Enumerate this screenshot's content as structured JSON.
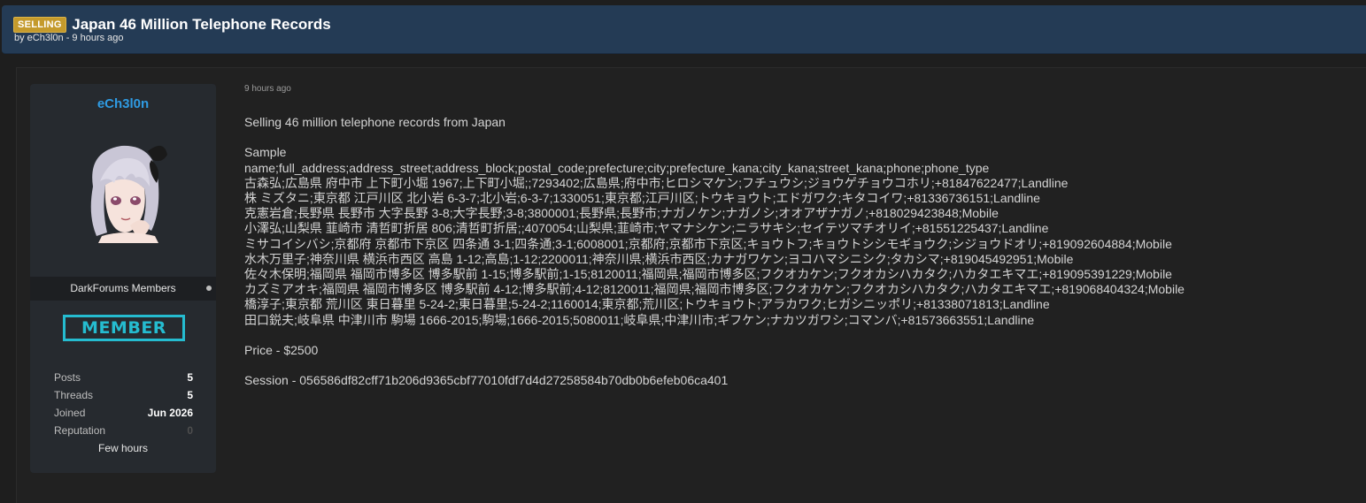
{
  "header": {
    "prefix": "SELLING",
    "title": "Japan 46 Million Telephone Records",
    "byline": "by eCh3l0n - 9 hours ago"
  },
  "user": {
    "name": "eCh3l0n",
    "group": "DarkForums Members",
    "rank": "MEMBER",
    "stats": [
      {
        "label": "Posts",
        "value": "5"
      },
      {
        "label": "Threads",
        "value": "5"
      },
      {
        "label": "Joined",
        "value": "Jun 2026"
      },
      {
        "label": "Reputation",
        "value": "0"
      }
    ],
    "last_seen": "Few hours"
  },
  "post": {
    "date": "9 hours ago",
    "intro": "Selling 46 million telephone records from Japan",
    "sample_label": "Sample",
    "sample_lines": [
      "name;full_address;address_street;address_block;postal_code;prefecture;city;prefecture_kana;city_kana;street_kana;phone;phone_type",
      "古森弘;広島県 府中市 上下町小堀 1967;上下町小堀;;7293402;広島県;府中市;ヒロシマケン;フチュウシ;ジョウゲチョウコホリ;+81847622477;Landline",
      "株 ミズタニ;東京都 江戸川区 北小岩 6-3-7;北小岩;6-3-7;1330051;東京都;江戸川区;トウキョウト;エドガワク;キタコイワ;+81336736151;Landline",
      "克憲岩倉;長野県 長野市 大字長野 3-8;大字長野;3-8;3800001;長野県;長野市;ナガノケン;ナガノシ;オオアザナガノ;+818029423848;Mobile",
      "小澤弘;山梨県 韮崎市 清哲町折居 806;清哲町折居;;4070054;山梨県;韮崎市;ヤマナシケン;ニラサキシ;セイテツマチオリイ;+81551225437;Landline",
      "ミサコイシバシ;京都府 京都市下京区 四条通 3-1;四条通;3-1;6008001;京都府;京都市下京区;キョウトフ;キョウトシシモギョウク;シジョウドオリ;+819092604884;Mobile",
      "水木万里子;神奈川県 横浜市西区 高島 1-12;高島;1-12;2200011;神奈川県;横浜市西区;カナガワケン;ヨコハマシニシク;タカシマ;+819045492951;Mobile",
      "佐々木保明;福岡県 福岡市博多区 博多駅前 1-15;博多駅前;1-15;8120011;福岡県;福岡市博多区;フクオカケン;フクオカシハカタク;ハカタエキマエ;+819095391229;Mobile",
      "カズミアオキ;福岡県 福岡市博多区 博多駅前 4-12;博多駅前;4-12;8120011;福岡県;福岡市博多区;フクオカケン;フクオカシハカタク;ハカタエキマエ;+819068404324;Mobile",
      "橋淳子;東京都 荒川区 東日暮里 5-24-2;東日暮里;5-24-2;1160014;東京都;荒川区;トウキョウト;アラカワク;ヒガシニッポリ;+81338071813;Landline",
      "田口鋭夫;岐阜県 中津川市 駒場 1666-2015;駒場;1666-2015;5080011;岐阜県;中津川市;ギフケン;ナカツガワシ;コマンバ;+81573663551;Landline"
    ],
    "price": "Price - $2500",
    "session": "Session - 056586df82cff71b206d9365cbf77010fdf7d4d27258584b70db0b6efeb06ca401"
  }
}
